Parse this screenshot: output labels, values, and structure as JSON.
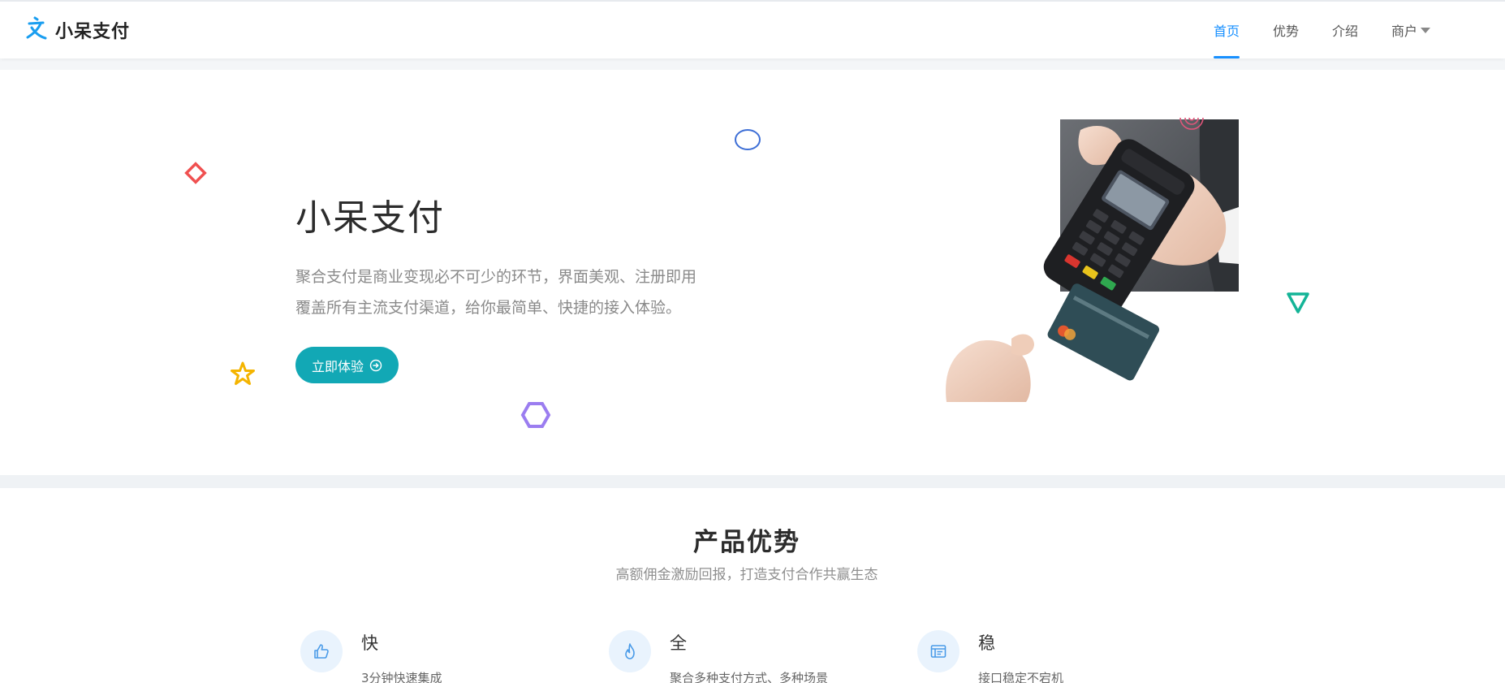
{
  "brand": {
    "name": "小呆支付",
    "logo_icon": "zhi-logo-icon",
    "logo_color": "#1a9ef0"
  },
  "nav": {
    "items": [
      {
        "label": "首页",
        "active": true
      },
      {
        "label": "优势",
        "active": false
      },
      {
        "label": "介绍",
        "active": false
      },
      {
        "label": "商户",
        "active": false,
        "dropdown": true
      }
    ],
    "active_color": "#1890ff"
  },
  "hero": {
    "title": "小呆支付",
    "desc_lines": [
      "聚合支付是商业变现必不可少的环节，界面美观、注册即用",
      "覆盖所有主流支付渠道，给你最简单、快捷的接入体验。"
    ],
    "cta_label": "立即体验",
    "cta_icon": "arrow-circle-right-icon",
    "cta_color": "#12a8b5",
    "image": "pos-terminal-card-payment-photo"
  },
  "advantages": {
    "title": "产品优势",
    "subtitle": "高额佣金激励回报，打造支付合作共赢生态",
    "items": [
      {
        "icon": "thumbs-up-icon",
        "title": "快",
        "desc": "3分钟快速集成"
      },
      {
        "icon": "flame-icon",
        "title": "全",
        "desc": "聚合多种支付方式、多种场景"
      },
      {
        "icon": "browser-window-icon",
        "title": "稳",
        "desc": "接口稳定不宕机"
      }
    ]
  },
  "decor_colors": {
    "diamond": "#f05050",
    "ellipse": "#3e6fd6",
    "spiral": "#e0557a",
    "triangle": "#14b497",
    "star": "#f4b400",
    "hexagon": "#9b7df0"
  }
}
